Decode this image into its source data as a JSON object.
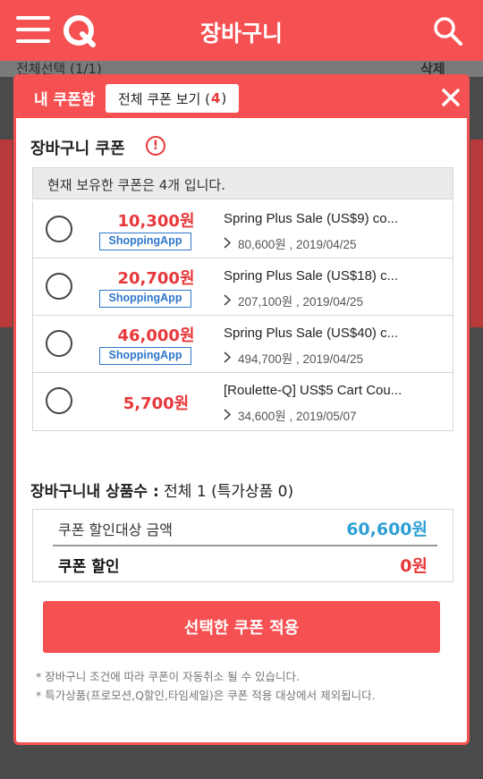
{
  "app": {
    "title": "장바구니",
    "behind_select_all": "전체선택 (1/1)",
    "behind_delete": "삭제"
  },
  "modal": {
    "title": "내 쿠폰함",
    "all_coupons_label": "전체 쿠폰 보기 (",
    "all_coupons_count": "4",
    "all_coupons_suffix": ")",
    "section_title": "장바구니 쿠폰",
    "info_symbol": "!",
    "owned_text": "현재 보유한 쿠폰은 4개 입니다.",
    "coupons": [
      {
        "amount": "10,300원",
        "tag": "ShoppingApp",
        "name": "Spring Plus Sale (US$9) co...",
        "condition": "80,600원 , 2019/04/25"
      },
      {
        "amount": "20,700원",
        "tag": "ShoppingApp",
        "name": "Spring Plus Sale (US$18) c...",
        "condition": "207,100원 , 2019/04/25"
      },
      {
        "amount": "46,000원",
        "tag": "ShoppingApp",
        "name": "Spring Plus Sale (US$40) c...",
        "condition": "494,700원 , 2019/04/25"
      },
      {
        "amount": "5,700원",
        "tag": "",
        "name": "[Roulette-Q] US$5 Cart Cou...",
        "condition": "34,600원 , 2019/05/07"
      }
    ],
    "count_label": "장바구니내 상품수 :",
    "count_value": "전체 1 (특가상품 0)",
    "target_amount_label": "쿠폰 할인대상 금액",
    "target_amount_value": "60,600원",
    "discount_label": "쿠폰 할인",
    "discount_value": "0원",
    "apply_button": "선택한 쿠폰 적용",
    "notes": [
      "* 장바구니 조건에 따라 쿠폰이 자동취소 될 수 있습니다.",
      "* 특가상품(프로모션,Q할인,타임세일)은 쿠폰 적용 대상에서 제외됩니다."
    ]
  },
  "colors": {
    "brand_red": "#f65152",
    "amount_red": "#e8383b",
    "tag_blue": "#2f77c9",
    "value_blue": "#2f9fd6"
  },
  "icons": [
    "menu-icon",
    "q-logo-icon",
    "search-icon",
    "close-icon",
    "info-icon",
    "chevron-right-icon",
    "radio-icon"
  ]
}
